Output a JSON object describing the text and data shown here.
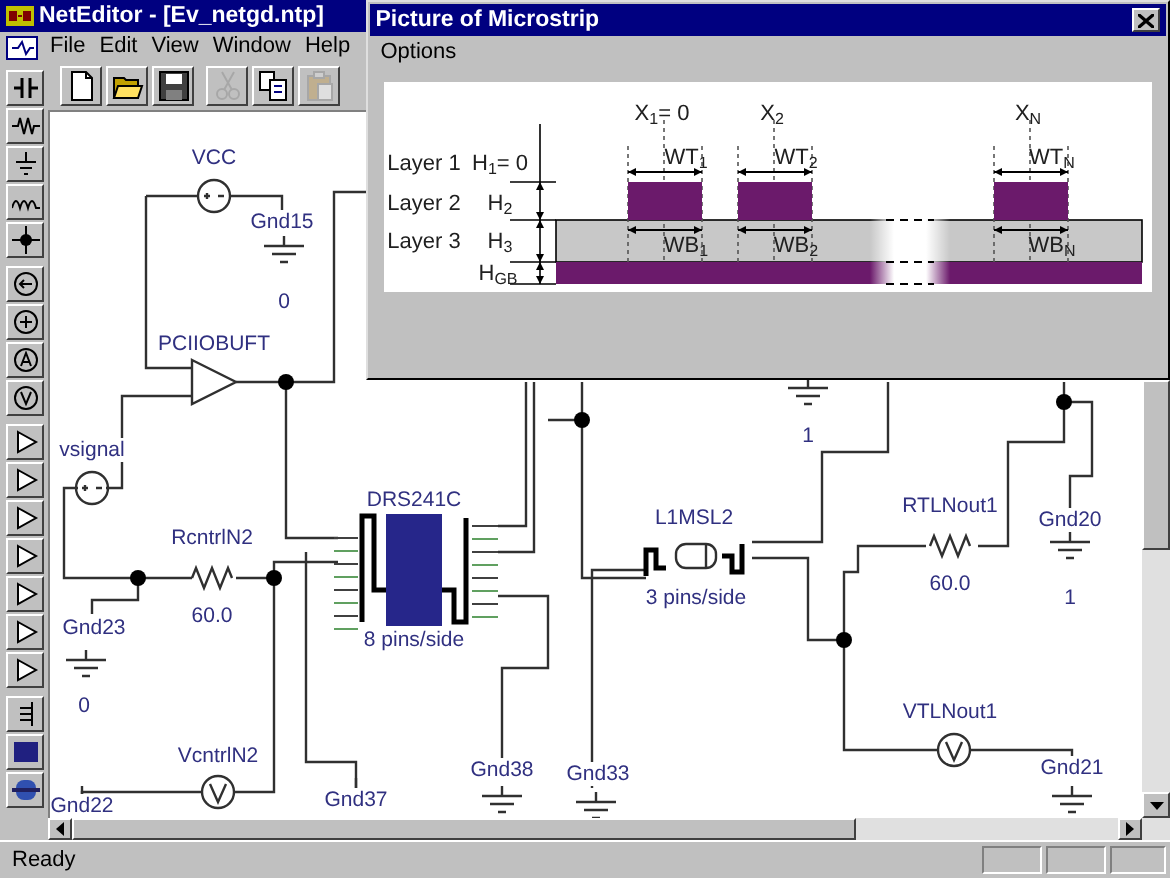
{
  "window": {
    "title": "NetEditor - [Ev_netgd.ntp]"
  },
  "menu": [
    {
      "label": "File"
    },
    {
      "label": "Edit"
    },
    {
      "label": "View"
    },
    {
      "label": "Window"
    },
    {
      "label": "Help"
    }
  ],
  "toolbar": [
    {
      "kind": "new",
      "disabled": false
    },
    {
      "kind": "open",
      "disabled": false
    },
    {
      "kind": "save",
      "disabled": false
    },
    {
      "kind": "cut",
      "disabled": true
    },
    {
      "kind": "copy",
      "disabled": false
    },
    {
      "kind": "paste",
      "disabled": true
    }
  ],
  "palette": [
    {
      "kind": "capacitor"
    },
    {
      "kind": "resistor"
    },
    {
      "kind": "ground"
    },
    {
      "kind": "inductor"
    },
    {
      "kind": "node"
    },
    {
      "kind": "current-source"
    },
    {
      "kind": "voltage-source"
    },
    {
      "kind": "ammeter"
    },
    {
      "kind": "voltmeter"
    },
    {
      "kind": "amplifier"
    },
    {
      "kind": "amplifier"
    },
    {
      "kind": "amplifier"
    },
    {
      "kind": "amplifier"
    },
    {
      "kind": "amplifier"
    },
    {
      "kind": "amplifier"
    },
    {
      "kind": "amplifier"
    },
    {
      "kind": "bus"
    },
    {
      "kind": "chip"
    },
    {
      "kind": "device"
    }
  ],
  "schematic": {
    "components": [
      {
        "kind": "source",
        "name": "VCC"
      },
      {
        "kind": "ground",
        "name": "Gnd15",
        "value": "0"
      },
      {
        "kind": "buffer",
        "name": "PCIIOBUFT"
      },
      {
        "kind": "source",
        "name": "vsignal"
      },
      {
        "kind": "resistor",
        "name": "RcntrlN2",
        "value": "60.0"
      },
      {
        "kind": "chip",
        "name": "DRS241C",
        "value": "8 pins/side"
      },
      {
        "kind": "ground",
        "value": "1"
      },
      {
        "kind": "line",
        "name": "L1MSL2",
        "value": "3 pins/side"
      },
      {
        "kind": "resistor",
        "name": "RTLNout1",
        "value": "60.0"
      },
      {
        "kind": "ground",
        "name": "Gnd20",
        "value": "1"
      },
      {
        "kind": "ground",
        "name": "Gnd23",
        "value": "0"
      },
      {
        "kind": "meter",
        "name": "VcntrlN2"
      },
      {
        "kind": "ground-label",
        "name": "Gnd22"
      },
      {
        "kind": "ground-label",
        "name": "Gnd37"
      },
      {
        "kind": "ground",
        "name": "Gnd38"
      },
      {
        "kind": "ground",
        "name": "Gnd33"
      },
      {
        "kind": "meter",
        "name": "VTLNout1"
      },
      {
        "kind": "ground",
        "name": "Gnd21"
      }
    ]
  },
  "picture_window": {
    "title": "Picture of Microstrip",
    "menu": [
      {
        "label": "Options"
      }
    ],
    "layers": [
      {
        "label": "Layer 1",
        "height": "H$_{1}$= 0"
      },
      {
        "label": "Layer 2",
        "height": "H$_{2}$"
      },
      {
        "label": "Layer 3",
        "height": "H$_{3}$"
      }
    ],
    "ground_height": "H$_{GB}$",
    "strips": [
      {
        "x": "X$_{1}$= 0",
        "top_width": "WT$_{1}$",
        "bottom_width": "WB$_{1}$"
      },
      {
        "x": "X$_{2}$",
        "top_width": "WT$_{2}$",
        "bottom_width": "WB$_{2}$"
      },
      {
        "x": "X$_{N}$",
        "top_width": "WT$_{N}$",
        "bottom_width": "WB$_{N}$"
      }
    ]
  },
  "status_bar": {
    "text": "Ready"
  }
}
